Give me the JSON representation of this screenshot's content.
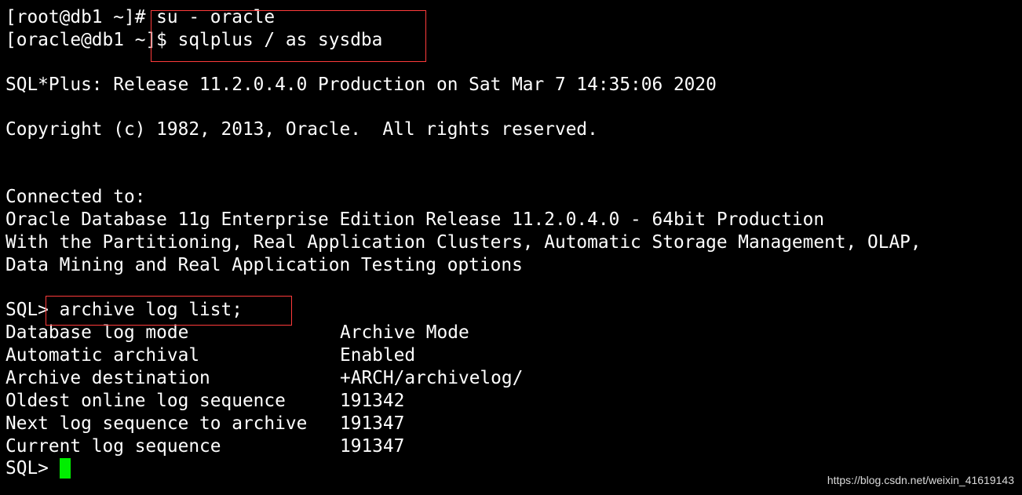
{
  "terminal": {
    "background": "#000000",
    "text_color": "#ffffff",
    "cursor_color": "#00ee00",
    "highlight_color": "#ff3b3b",
    "lines": {
      "l1_prompt": "[root@db1 ~]# ",
      "l1_cmd": "su - oracle",
      "l2_prompt": "[oracle@db1 ~]$ ",
      "l2_cmd": "sqlplus / as sysdba",
      "l3": "SQL*Plus: Release 11.2.0.4.0 Production on Sat Mar 7 14:35:06 2020",
      "l4": "Copyright (c) 1982, 2013, Oracle.  All rights reserved.",
      "l5": "Connected to:",
      "l6": "Oracle Database 11g Enterprise Edition Release 11.2.0.4.0 - 64bit Production",
      "l7": "With the Partitioning, Real Application Clusters, Automatic Storage Management, OLAP,",
      "l8": "Data Mining and Real Application Testing options",
      "l9_prompt": "SQL> ",
      "l9_cmd": "archive log list;",
      "last_prompt": "SQL> "
    },
    "archive_output": [
      {
        "label": "Database log mode",
        "value": "Archive Mode"
      },
      {
        "label": "Automatic archival",
        "value": "Enabled"
      },
      {
        "label": "Archive destination",
        "value": "+ARCH/archivelog/"
      },
      {
        "label": "Oldest online log sequence",
        "value": "191342"
      },
      {
        "label": "Next log sequence to archive",
        "value": "191347"
      },
      {
        "label": "Current log sequence",
        "value": "191347"
      }
    ]
  },
  "watermark": "https://blog.csdn.net/weixin_41619143"
}
